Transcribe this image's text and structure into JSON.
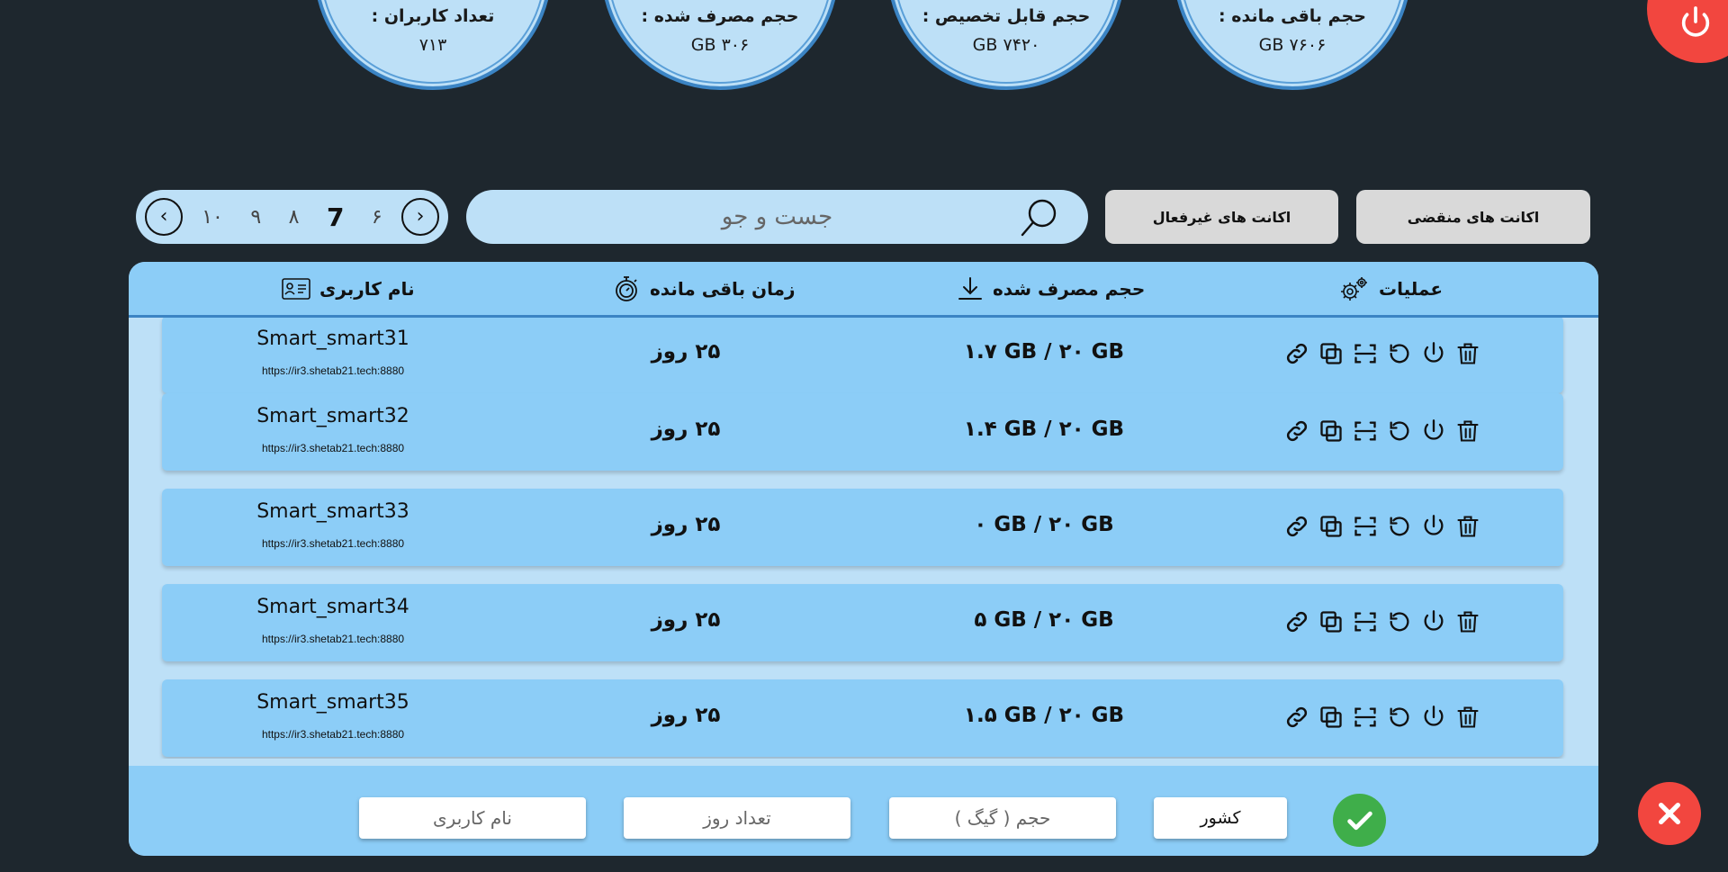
{
  "stats": {
    "users": {
      "label": "تعداد کاربران :",
      "value": "۷۱۳"
    },
    "used": {
      "label": "حجم مصرف شده :",
      "value": "۳۰۶ GB"
    },
    "allocatable": {
      "label": "حجم قابل تخصیص :",
      "value": "۷۴۲۰ GB"
    },
    "remaining": {
      "label": "حجم باقی مانده :",
      "value": "۷۶۰۶ GB"
    }
  },
  "pager": {
    "prev_arrow": "‹",
    "next_arrow": "›",
    "pages": [
      "۱۰",
      "۹",
      "۸",
      "7",
      "۶"
    ],
    "active_page": "7"
  },
  "search": {
    "placeholder": "جست و جو"
  },
  "tabs": {
    "inactive": "اکانت های غیرفعال",
    "expired": "اکانت های منقضی"
  },
  "table": {
    "headers": {
      "username": "نام کاربری",
      "remaining_time": "زمان باقی مانده",
      "used_volume": "حجم مصرف شده",
      "operations": "عملیات"
    },
    "rows": [
      {
        "username": "Smart_smart31",
        "url": "https://ir3.shetab21.tech:8880",
        "time": "۲۵ روز",
        "volume": "۱.۷ GB / ۲۰ GB"
      },
      {
        "username": "Smart_smart32",
        "url": "https://ir3.shetab21.tech:8880",
        "time": "۲۵ روز",
        "volume": "۱.۴ GB / ۲۰ GB"
      },
      {
        "username": "Smart_smart33",
        "url": "https://ir3.shetab21.tech:8880",
        "time": "۲۵ روز",
        "volume": "۰ GB / ۲۰ GB"
      },
      {
        "username": "Smart_smart34",
        "url": "https://ir3.shetab21.tech:8880",
        "time": "۲۵ روز",
        "volume": "۵ GB / ۲۰ GB"
      },
      {
        "username": "Smart_smart35",
        "url": "https://ir3.shetab21.tech:8880",
        "time": "۲۵ روز",
        "volume": "۱.۵ GB / ۲۰ GB"
      }
    ]
  },
  "footer": {
    "username_placeholder": "نام کاربری",
    "days_placeholder": "تعداد روز",
    "volume_placeholder": "حجم ( گیگ )",
    "country_value": "کشور"
  }
}
